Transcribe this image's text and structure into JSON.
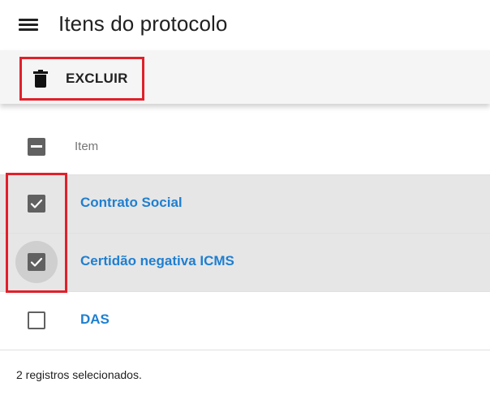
{
  "header": {
    "title": "Itens do protocolo",
    "menu_icon": "hamburger-menu-icon"
  },
  "toolbar": {
    "delete_label": "EXCLUIR",
    "delete_icon": "trash-icon"
  },
  "table": {
    "column_header": "Item",
    "select_all_state": "indeterminate",
    "rows": [
      {
        "label": "Contrato Social",
        "checked": true
      },
      {
        "label": "Certidão negativa ICMS",
        "checked": true
      },
      {
        "label": "DAS",
        "checked": false
      }
    ]
  },
  "footer": {
    "status": "2 registros selecionados."
  },
  "colors": {
    "link": "#1e7fd1",
    "highlight": "#e0202a",
    "selected_row": "#e6e6e6",
    "toolbar_bg": "#f5f5f5"
  }
}
